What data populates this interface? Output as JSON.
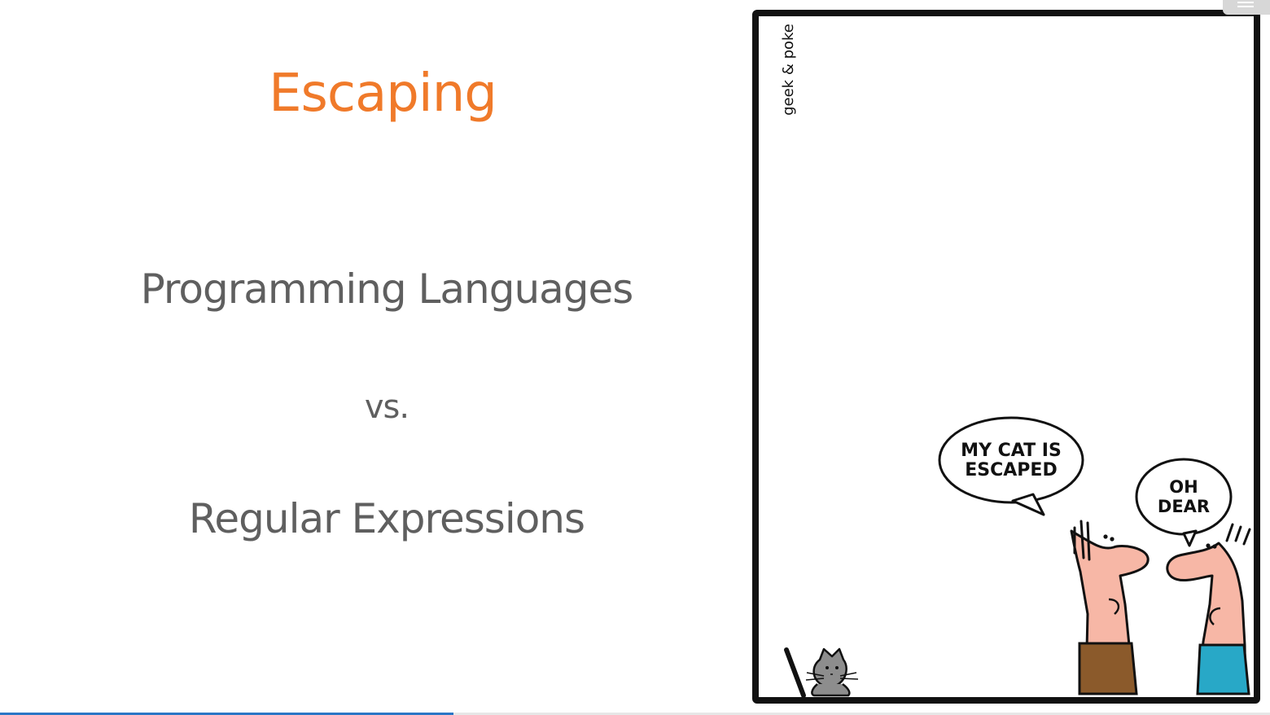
{
  "slide": {
    "title": "Escaping",
    "line1": "Programming Languages",
    "line2": "vs.",
    "line3": "Regular Expressions"
  },
  "comic": {
    "credit": "geek & poke",
    "bubble1_line1": "MY CAT IS",
    "bubble1_line2": "ESCAPED",
    "bubble2_line1": "OH",
    "bubble2_line2": "DEAR"
  },
  "progress": {
    "fraction": 0.357
  },
  "colors": {
    "title": "#f07a2a",
    "text": "#5f5f5f",
    "progress": "#2a76c6",
    "skin": "#f7b7a6",
    "pants_left": "#8b5a2b",
    "pants_right": "#28a8c7",
    "cat": "#8d8d8d"
  },
  "icons": {
    "menu": "menu-icon"
  }
}
